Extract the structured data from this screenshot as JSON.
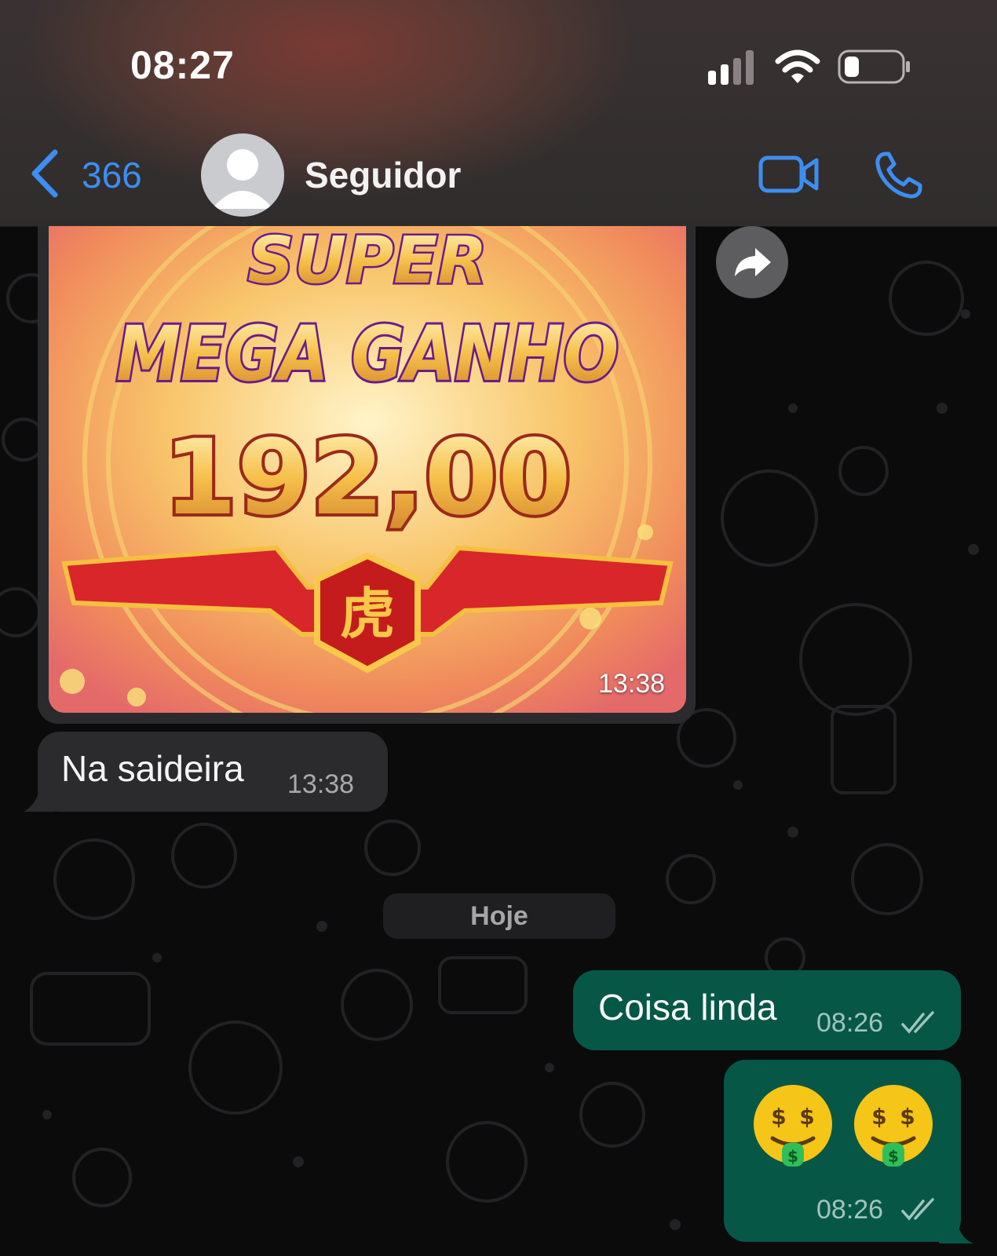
{
  "status_bar": {
    "time": "08:27"
  },
  "header": {
    "back_count": "366",
    "contact_name": "Seguidor"
  },
  "icons": {
    "back": "chevron-left-icon",
    "video": "video-camera-icon",
    "call": "phone-icon",
    "forward": "share-arrow-icon",
    "avatar": "default-avatar-icon",
    "read_ticks": "double-check-icon",
    "emoji": "money-mouth-face"
  },
  "messages": {
    "image": {
      "text_line1": "SUPER",
      "text_line2": "MEGA GANHO",
      "amount": "192,00",
      "emblem": "虎",
      "time": "13:38"
    },
    "incoming_text": {
      "text": "Na saideira",
      "time": "13:38"
    },
    "date_separator": "Hoje",
    "outgoing_text": {
      "text": "Coisa linda",
      "time": "08:26"
    },
    "outgoing_emoji": {
      "emoji": "🤑 🤑",
      "time": "08:26"
    }
  },
  "colors": {
    "accent": "#3d8ef0",
    "incoming_bubble": "#2b2b2d",
    "outgoing_bubble": "#075747",
    "background": "#0b0b0c"
  }
}
